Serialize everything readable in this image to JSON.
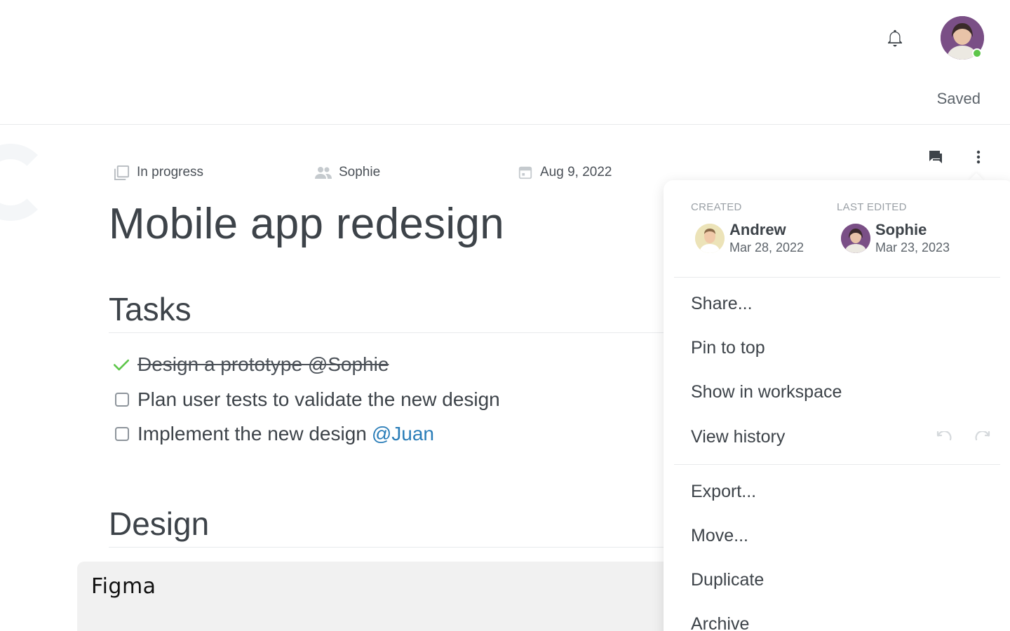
{
  "header": {
    "status_text": "Saved"
  },
  "meta": {
    "status": "In progress",
    "owner": "Sophie",
    "due_date": "Aug 9, 2022"
  },
  "page_title": "Mobile app redesign",
  "sections": {
    "tasks_heading": "Tasks",
    "design_heading": "Design"
  },
  "tasks": [
    {
      "text": "Design a prototype @Sophie",
      "done": true
    },
    {
      "text": "Plan user tests to validate the new design",
      "done": false
    },
    {
      "text": "Implement the new design",
      "mention": "@Juan",
      "done": false
    }
  ],
  "embed": {
    "label": "Figma"
  },
  "menu": {
    "created_label": "CREATED",
    "created_by": "Andrew",
    "created_date": "Mar 28, 2022",
    "edited_label": "LAST EDITED",
    "edited_by": "Sophie",
    "edited_date": "Mar 23, 2023",
    "items": [
      "Share...",
      "Pin to top",
      "Show in workspace",
      "View history",
      "Export...",
      "Move...",
      "Duplicate",
      "Archive"
    ]
  },
  "icons": [
    "bell-icon",
    "avatar",
    "comments-icon",
    "more-vertical-icon",
    "status-icon",
    "people-icon",
    "calendar-icon",
    "check-icon",
    "undo-icon",
    "redo-icon"
  ],
  "colors": {
    "accent_link": "#2a7db8",
    "check_green": "#5ec64a",
    "online_green": "#5ec64a",
    "text": "#3d4349"
  }
}
